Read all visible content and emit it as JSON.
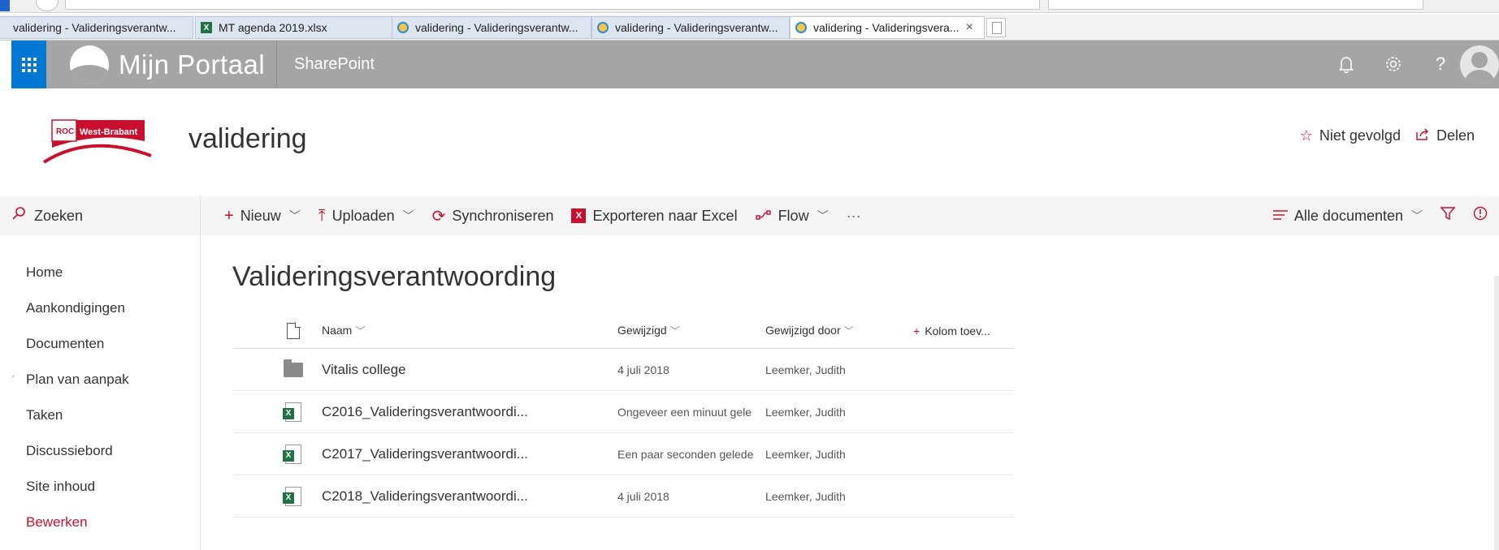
{
  "browser": {
    "tabs": [
      {
        "label": "validering - Valideringsverantw...",
        "icon": "ie-icon",
        "active": false
      },
      {
        "label": "MT agenda 2019.xlsx",
        "icon": "excel-icon",
        "active": false
      },
      {
        "label": "validering - Valideringsverantw...",
        "icon": "ie-icon",
        "active": false
      },
      {
        "label": "validering - Valideringsverantw...",
        "icon": "ie-icon",
        "active": false
      },
      {
        "label": "validering - Valideringsvera...",
        "icon": "ie-icon",
        "active": true
      }
    ],
    "tab_close": "×"
  },
  "suitebar": {
    "brand": "Mijn Portaal",
    "app": "SharePoint",
    "bell_icon": "🔔",
    "gear_icon": "⚙",
    "help_icon": "?",
    "accent": "#0078d4",
    "bar_color": "#a5a5a5"
  },
  "site": {
    "logo_text_left": "ROC",
    "logo_text_right": "West-Brabant",
    "title": "validering",
    "follow_label": "Niet gevolgd",
    "share_label": "Delen"
  },
  "commandbar": {
    "search_label": "Zoeken",
    "new_label": "Nieuw",
    "upload_label": "Uploaden",
    "sync_label": "Synchroniseren",
    "export_label": "Exporteren naar Excel",
    "flow_label": "Flow",
    "more_label": "···",
    "view_label": "Alle documenten"
  },
  "nav": {
    "items": [
      {
        "label": "Home"
      },
      {
        "label": "Aankondigingen"
      },
      {
        "label": "Documenten"
      },
      {
        "label": "Plan van aanpak"
      },
      {
        "label": "Taken"
      },
      {
        "label": "Discussiebord"
      },
      {
        "label": "Site inhoud"
      }
    ],
    "edit_label": "Bewerken"
  },
  "library": {
    "title": "Valideringsverantwoording",
    "columns": {
      "name": "Naam",
      "modified": "Gewijzigd",
      "modified_by": "Gewijzigd door",
      "add_column": "Kolom toev..."
    },
    "rows": [
      {
        "type": "folder",
        "name": "Vitalis college",
        "modified": "4 juli 2018",
        "modified_by": "Leemker, Judith"
      },
      {
        "type": "excel",
        "name": "C2016_Valideringsverantwoordi...",
        "modified": "Ongeveer een minuut gele",
        "modified_by": "Leemker, Judith"
      },
      {
        "type": "excel",
        "name": "C2017_Valideringsverantwoordi...",
        "modified": "Een paar seconden gelede",
        "modified_by": "Leemker, Judith"
      },
      {
        "type": "excel",
        "name": "C2018_Valideringsverantwoordi...",
        "modified": "4 juli 2018",
        "modified_by": "Leemker, Judith"
      }
    ]
  }
}
